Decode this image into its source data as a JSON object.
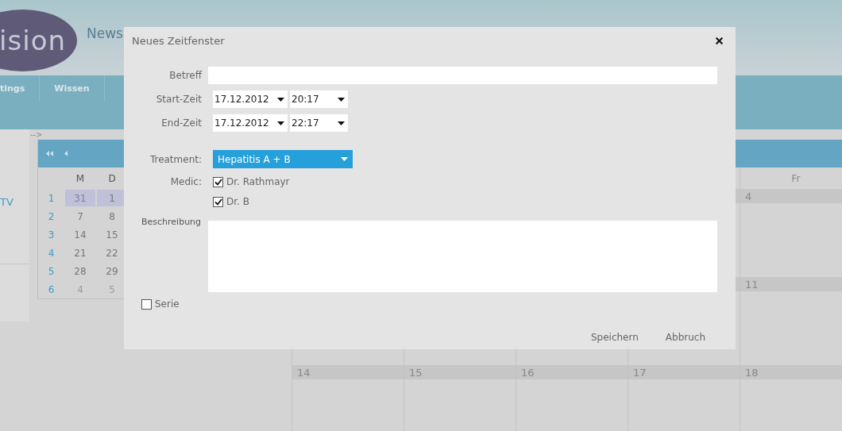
{
  "app": {
    "logo_text": "ision",
    "header_link": "News",
    "nav": [
      {
        "label": "tings"
      },
      {
        "label": "Wissen"
      }
    ],
    "sidebar_item": "TV",
    "arrow_text": "-->"
  },
  "mini_calendar": {
    "weekday_headers": [
      "M",
      "D"
    ],
    "weeks": [
      {
        "week": "1",
        "selected": true,
        "days": [
          {
            "label": "31",
            "other_month": true
          },
          {
            "label": "1",
            "other_month": false
          }
        ]
      },
      {
        "week": "2",
        "selected": false,
        "days": [
          {
            "label": "7",
            "other_month": false
          },
          {
            "label": "8",
            "other_month": false
          }
        ]
      },
      {
        "week": "3",
        "selected": false,
        "days": [
          {
            "label": "14",
            "other_month": false
          },
          {
            "label": "15",
            "other_month": false
          }
        ]
      },
      {
        "week": "4",
        "selected": false,
        "days": [
          {
            "label": "21",
            "other_month": false
          },
          {
            "label": "22",
            "other_month": false
          }
        ]
      },
      {
        "week": "5",
        "selected": false,
        "days": [
          {
            "label": "28",
            "other_month": false
          },
          {
            "label": "29",
            "other_month": false
          }
        ]
      },
      {
        "week": "6",
        "selected": false,
        "days": [
          {
            "label": "4",
            "other_month": true
          },
          {
            "label": "5",
            "other_month": true
          }
        ]
      }
    ]
  },
  "calendar": {
    "weekday_headers": [
      "Fr"
    ],
    "weeks": [
      {
        "days": [
          "4"
        ]
      },
      {
        "days": [
          "11"
        ]
      },
      {
        "days": [
          "14",
          "15",
          "16",
          "17",
          "18"
        ]
      }
    ]
  },
  "dialog": {
    "title": "Neues Zeitfenster",
    "subject": {
      "label": "Betreff"
    },
    "start": {
      "label": "Start-Zeit",
      "date": "17.12.2012",
      "time": "20:17"
    },
    "end": {
      "label": "End-Zeit",
      "date": "17.12.2012",
      "time": "22:17"
    },
    "treatment": {
      "label": "Treatment:",
      "value": "Hepatitis A + B"
    },
    "medic": {
      "label": "Medic:",
      "options": [
        {
          "label": "Dr. Rathmayr",
          "checked": true
        },
        {
          "label": "Dr. B",
          "checked": true
        }
      ]
    },
    "description": {
      "label": "Beschreibung"
    },
    "series": {
      "label": "Serie",
      "checked": false
    },
    "buttons": [
      "Speichern",
      "Abbruch"
    ]
  }
}
